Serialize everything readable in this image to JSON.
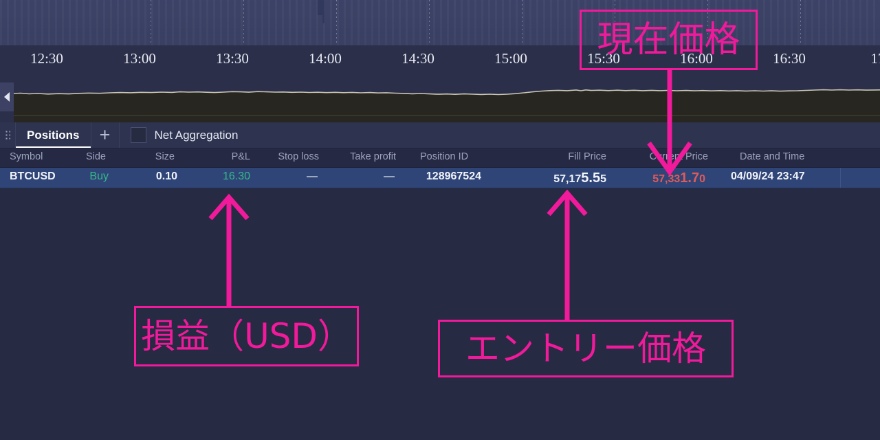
{
  "chart": {
    "time_axis_labels": [
      "12:30",
      "13:00",
      "13:30",
      "14:00",
      "14:30",
      "15:00",
      "15:30",
      "16:00",
      "16:30",
      "17"
    ],
    "collapse_handle_icon": "chevron-left-icon"
  },
  "panel": {
    "drag_handle_icon": "drag-dots-icon",
    "tab_label": "Positions",
    "add_tab_icon": "plus-icon",
    "net_aggregation_label": "Net Aggregation",
    "net_aggregation_checked": false
  },
  "table": {
    "columns": [
      "Symbol",
      "Side",
      "Size",
      "P&L",
      "Stop loss",
      "Take profit",
      "Position ID",
      "Fill Price",
      "Current Price",
      "Date and Time"
    ],
    "row": {
      "symbol": "BTCUSD",
      "side": "Buy",
      "size": "0.10",
      "pnl": "16.30",
      "stop_loss": "—",
      "take_profit": "—",
      "position_id": "128967524",
      "fill_price": {
        "lead": "57,17",
        "mid": "5.5",
        "tail": "5"
      },
      "current_price": {
        "lead": "57,33",
        "mid": "1.7",
        "tail": "0"
      },
      "date_and_time": "04/09/24 23:47"
    }
  },
  "annotations": [
    {
      "id": "current-price",
      "text": "現在価格"
    },
    {
      "id": "pnl-usd",
      "text": "損益（USD）"
    },
    {
      "id": "entry-price",
      "text": "エントリー価格"
    }
  ],
  "colors": {
    "accent_pink": "#f01a9b",
    "buy_green": "#37b88a",
    "pnl_green": "#37b88a",
    "current_price_red": "#e05a5a",
    "row_selected": "#2f4577",
    "panel_bg": "#262a42"
  }
}
